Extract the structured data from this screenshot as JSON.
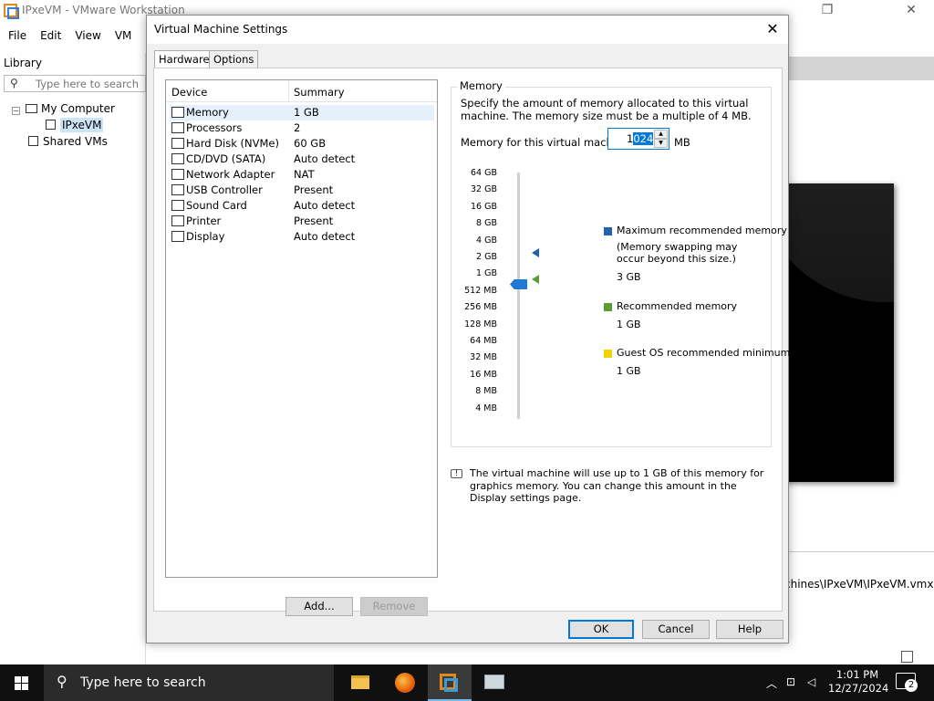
{
  "app": {
    "window_title": "IPxeVM - VMware Workstation",
    "menu": [
      "File",
      "Edit",
      "View",
      "VM"
    ],
    "library": {
      "title": "Library",
      "search_placeholder": "Type here to search",
      "tree": [
        {
          "label": "My Computer",
          "expander": "−"
        },
        {
          "label": "IPxeVM"
        },
        {
          "label": "Shared VMs"
        }
      ]
    },
    "vm_path": "chines\\IPxeVM\\IPxeVM.vmx"
  },
  "dialog": {
    "title": "Virtual Machine Settings",
    "close": "✕",
    "tabs": [
      "Hardware",
      "Options"
    ],
    "device_list": {
      "headers": [
        "Device",
        "Summary"
      ],
      "rows": [
        {
          "device": "Memory",
          "summary": "1 GB",
          "icon": "memory-icon",
          "selected": true
        },
        {
          "device": "Processors",
          "summary": "2",
          "icon": "processor-icon"
        },
        {
          "device": "Hard Disk (NVMe)",
          "summary": "60 GB",
          "icon": "hard-disk-icon"
        },
        {
          "device": "CD/DVD (SATA)",
          "summary": "Auto detect",
          "icon": "cd-dvd-icon"
        },
        {
          "device": "Network Adapter",
          "summary": "NAT",
          "icon": "network-adapter-icon"
        },
        {
          "device": "USB Controller",
          "summary": "Present",
          "icon": "usb-controller-icon"
        },
        {
          "device": "Sound Card",
          "summary": "Auto detect",
          "icon": "sound-card-icon"
        },
        {
          "device": "Printer",
          "summary": "Present",
          "icon": "printer-icon"
        },
        {
          "device": "Display",
          "summary": "Auto detect",
          "icon": "display-icon"
        }
      ]
    },
    "add_button": "Add...",
    "remove_button": "Remove",
    "memory": {
      "group_title": "Memory",
      "description": "Specify the amount of memory allocated to this virtual machine. The memory size must be a multiple of 4 MB.",
      "field_label": "Memory for this virtual machine:",
      "value_prefix": "1",
      "value_selected": "024",
      "unit": "MB",
      "scale": [
        "64 GB",
        "32 GB",
        "16 GB",
        "8 GB",
        "4 GB",
        "2 GB",
        "1 GB",
        "512 MB",
        "256 MB",
        "128 MB",
        "64 MB",
        "32 MB",
        "16 MB",
        "8 MB",
        "4 MB"
      ],
      "legend": {
        "max": {
          "label": "Maximum recommended memory",
          "note": "(Memory swapping may occur beyond this size.)",
          "value": "3 GB",
          "color": "#1e63b0"
        },
        "recommended": {
          "label": "Recommended memory",
          "value": "1 GB",
          "color": "#5a9e32"
        },
        "guest_min": {
          "label": "Guest OS recommended minimum",
          "value": "1 GB",
          "color": "#f2d200"
        }
      },
      "info": "The virtual machine will use up to 1 GB of this memory for graphics memory. You can change this amount in the Display settings page."
    },
    "buttons": {
      "ok": "OK",
      "cancel": "Cancel",
      "help": "Help"
    }
  },
  "taskbar": {
    "search_placeholder": "Type here to search",
    "time": "1:01 PM",
    "date": "12/27/2024",
    "notification_count": "2"
  }
}
